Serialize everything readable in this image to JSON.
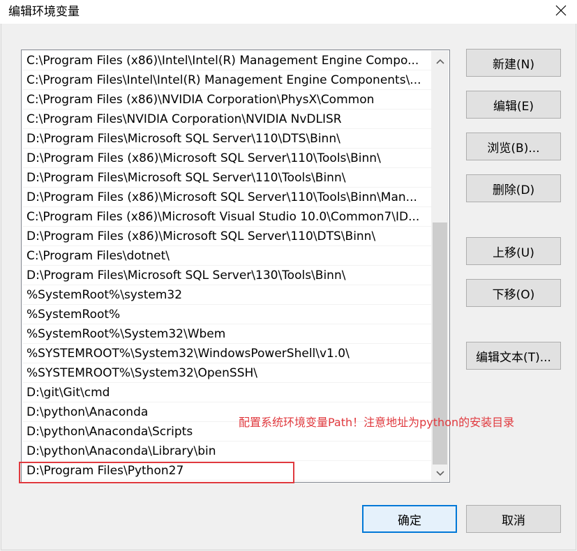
{
  "window": {
    "title": "编辑环境变量",
    "close_icon": "close-icon"
  },
  "path_list": {
    "items": [
      "C:\\Program Files (x86)\\Intel\\Intel(R) Management Engine Compo...",
      "C:\\Program Files\\Intel\\Intel(R) Management Engine Components\\...",
      "C:\\Program Files (x86)\\NVIDIA Corporation\\PhysX\\Common",
      "C:\\Program Files\\NVIDIA Corporation\\NVIDIA NvDLISR",
      "D:\\Program Files\\Microsoft SQL Server\\110\\DTS\\Binn\\",
      "D:\\Program Files (x86)\\Microsoft SQL Server\\110\\Tools\\Binn\\",
      "D:\\Program Files\\Microsoft SQL Server\\110\\Tools\\Binn\\",
      "D:\\Program Files (x86)\\Microsoft SQL Server\\110\\Tools\\Binn\\Man...",
      "C:\\Program Files (x86)\\Microsoft Visual Studio 10.0\\Common7\\ID...",
      "D:\\Program Files (x86)\\Microsoft SQL Server\\110\\DTS\\Binn\\",
      "C:\\Program Files\\dotnet\\",
      "D:\\Program Files\\Microsoft SQL Server\\130\\Tools\\Binn\\",
      "%SystemRoot%\\system32",
      "%SystemRoot%",
      "%SystemRoot%\\System32\\Wbem",
      "%SYSTEMROOT%\\System32\\WindowsPowerShell\\v1.0\\",
      "%SYSTEMROOT%\\System32\\OpenSSH\\",
      "D:\\git\\Git\\cmd",
      "D:\\python\\Anaconda",
      "D:\\python\\Anaconda\\Scripts",
      "D:\\python\\Anaconda\\Library\\bin",
      "D:\\Program Files\\Python27"
    ]
  },
  "annotation": {
    "text": "配置系统环境变量Path！注意地址为python的安装目录",
    "color": "#e0393e"
  },
  "buttons": {
    "new": "新建(N)",
    "edit": "编辑(E)",
    "browse": "浏览(B)...",
    "delete": "删除(D)",
    "move_up": "上移(U)",
    "move_down": "下移(O)",
    "edit_text": "编辑文本(T)...",
    "ok": "确定",
    "cancel": "取消"
  },
  "colors": {
    "accent": "#0078d7",
    "annotation_red": "#e0393e"
  }
}
